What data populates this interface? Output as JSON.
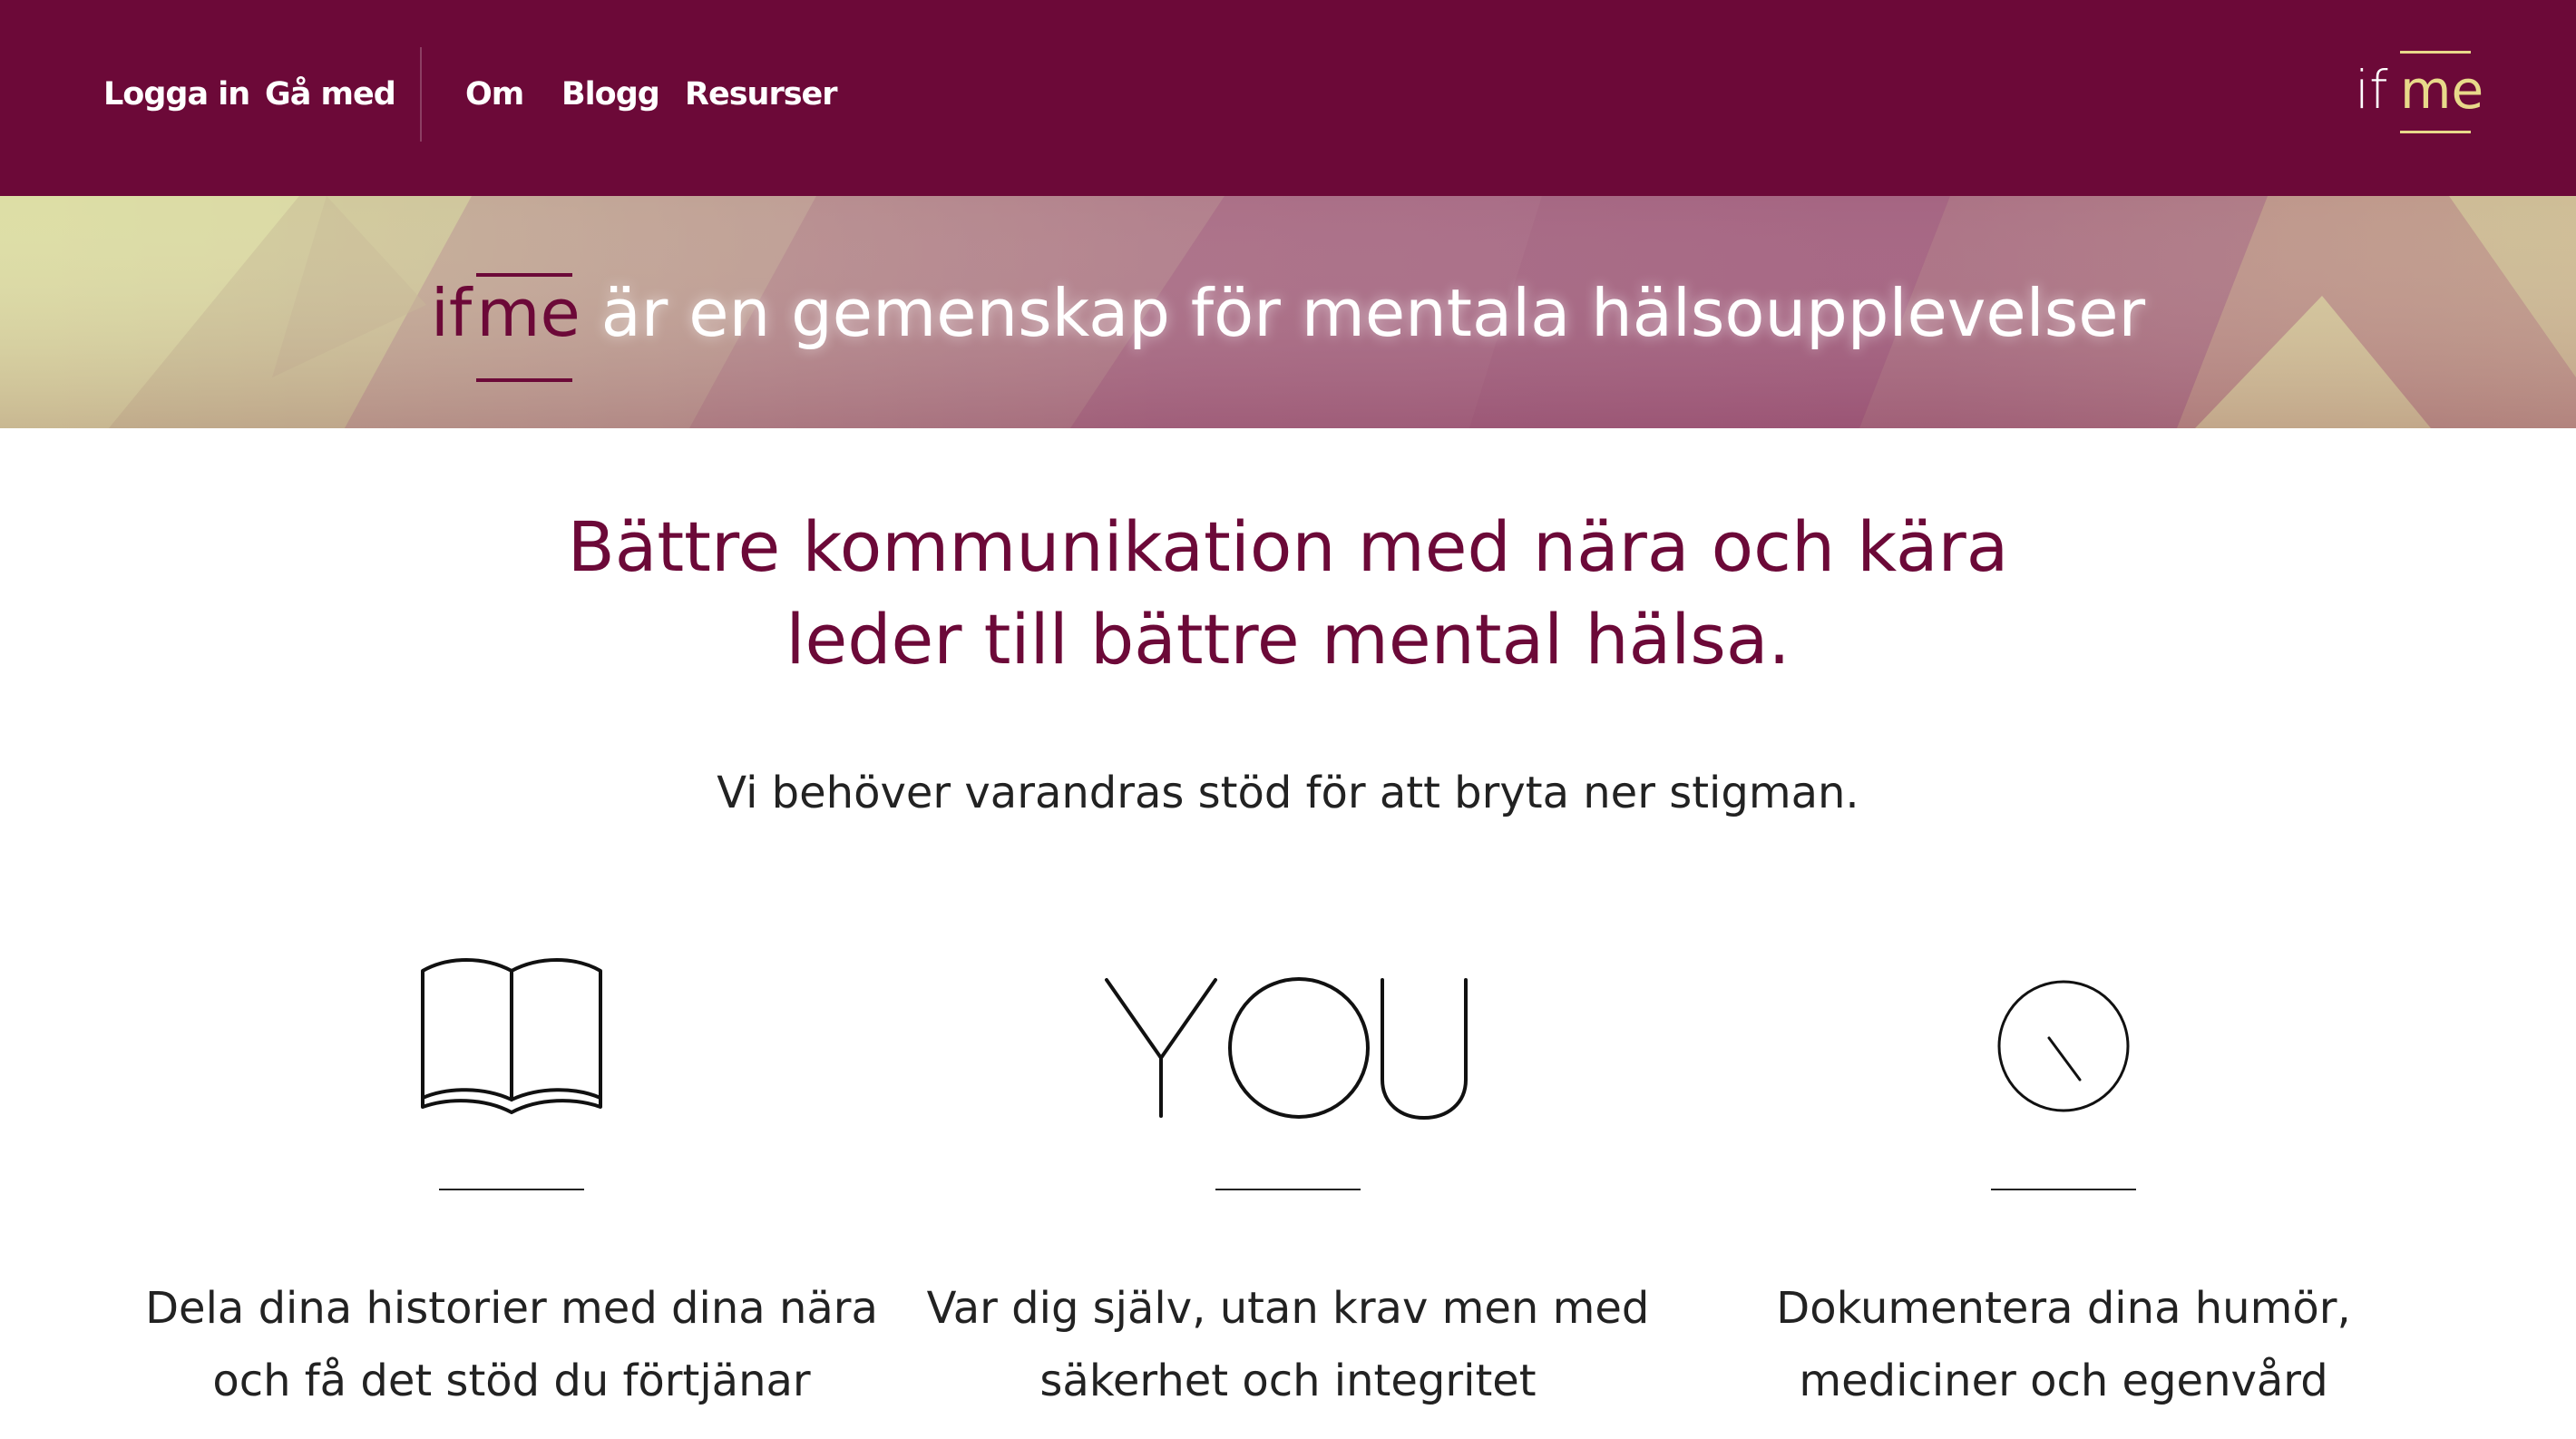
{
  "nav": {
    "login": "Logga in",
    "join": "Gå med",
    "about": "Om",
    "blog": "Blogg",
    "resources": "Resurser"
  },
  "logo": {
    "if": "if",
    "me": "me"
  },
  "banner": {
    "if": "if",
    "me": "me",
    "rest": " är en gemenskap för mentala hälsoupplevelser"
  },
  "headline": {
    "line1": "Bättre kommunikation med nära och kära",
    "line2": "leder till bättre mental hälsa."
  },
  "subline": "Vi behöver varandras stöd för att bryta ner stigman.",
  "features": [
    {
      "icon": "open-book-icon",
      "line1": "Dela dina historier med dina nära",
      "line2": "och få det stöd du förtjänar"
    },
    {
      "icon": "you-wordmark-icon",
      "icon_text": "YOU",
      "line1": "Var dig själv, utan krav men med",
      "line2": "säkerhet och integritet"
    },
    {
      "icon": "clock-icon",
      "line1": "Dokumentera dina humör,",
      "line2": "mediciner och egenvård"
    }
  ],
  "colors": {
    "brand": "#6c0938",
    "accent": "#e8d98a",
    "banner_light": "#d9dca0",
    "banner_dark": "#a05a78",
    "text": "#222222"
  }
}
